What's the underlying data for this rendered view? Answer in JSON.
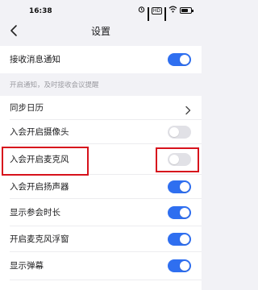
{
  "status_bar": {
    "time": "16:38",
    "icons": [
      "alarm-icon",
      "signal-icon",
      "hd-icon",
      "signal-icon",
      "wifi-icon",
      "battery-icon"
    ],
    "hd_label": "HD",
    "battery_level": 0.7
  },
  "nav": {
    "title": "设置",
    "back_icon": "chevron-left-icon"
  },
  "settings": {
    "receive_notifications": {
      "label": "接收消息通知",
      "enabled": true
    },
    "notifications_hint": "开启通知，及时接收会议提醒",
    "sync_calendar": {
      "label": "同步日历",
      "icon": "chevron-right-icon"
    },
    "camera_on_join": {
      "label": "入会开启摄像头",
      "enabled": false
    },
    "mic_on_join": {
      "label": "入会开启麦克风",
      "enabled": false
    },
    "speaker_on_join": {
      "label": "入会开启扬声器",
      "enabled": true
    },
    "show_duration": {
      "label": "显示参会时长",
      "enabled": true
    },
    "mic_float_window": {
      "label": "开启麦克风浮窗",
      "enabled": true
    },
    "show_danmaku": {
      "label": "显示弹幕",
      "enabled": true
    }
  },
  "colors": {
    "accent": "#2f6ff0",
    "toggle_off": "#e1e1e6",
    "highlight": "#d7121c",
    "background": "#f2f2f6",
    "hint_text": "#9a9aa0"
  }
}
